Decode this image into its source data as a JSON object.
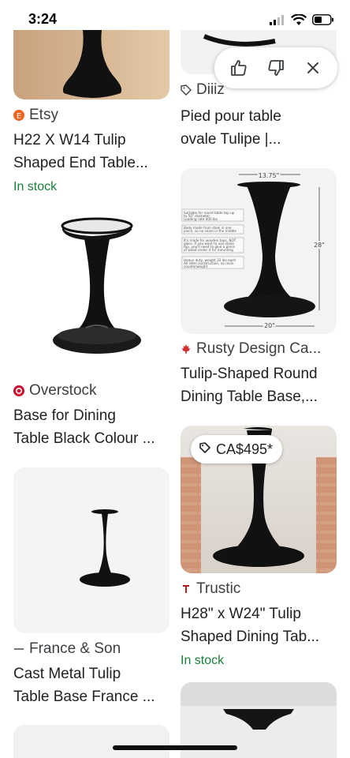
{
  "status_bar": {
    "time": "3:24"
  },
  "feedback": {
    "like": "thumbs-up-icon",
    "dislike": "thumbs-down-icon",
    "close": "close-icon"
  },
  "results": [
    {
      "source": "Etsy",
      "title_line1": "H22 X W14 Tulip",
      "title_line2": "Shaped End Table...",
      "stock": "In stock"
    },
    {
      "source": "Diiiz",
      "title_line1": "Pied pour table",
      "title_line2": "ovale Tulipe |..."
    },
    {
      "source": "Overstock",
      "title_line1": "Base for Dining",
      "title_line2": "Table Black Colour ..."
    },
    {
      "source": "Rusty Design Ca...",
      "title_line1": "Tulip-Shaped Round",
      "title_line2": "Dining Table Base,...",
      "diagram": {
        "width_label": "13.75\"",
        "height_label": "28\"",
        "base_label": "20\"",
        "notes": [
          "Suitable for round table top up",
          "to 50\" diameter",
          "Loading rate 400 lbs",
          "Body made from steel in one",
          "piece, so no seam in the middle",
          "It's made for wooden tops, NOT",
          "glass. If you want to use stone",
          "top, you'll need to glue a piece",
          "of wood under it for mounting",
          "Heavy duty, weight 32 lbs each",
          "All steel construction, no resin",
          "counterweight"
        ]
      }
    },
    {
      "source": "France & Son",
      "title_line1": "Cast Metal Tulip",
      "title_line2": "Table Base France ..."
    },
    {
      "source": "Trustic",
      "price": "CA$495*",
      "title_line1": "H28\" x W24\" Tulip",
      "title_line2": "Shaped Dining Tab...",
      "stock": "In stock"
    }
  ],
  "colors": {
    "in_stock": "#188038",
    "etsy": "#f1641e",
    "overstock": "#c8102e",
    "maple": "#d32f2f"
  }
}
